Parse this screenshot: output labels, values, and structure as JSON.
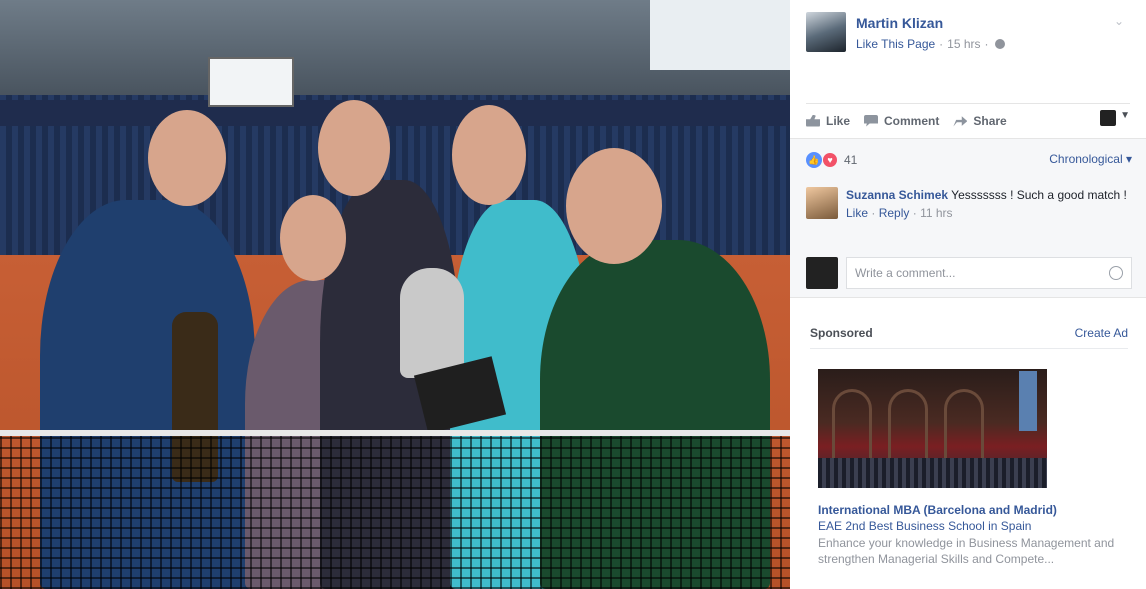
{
  "post": {
    "page_name": "Martin Klizan",
    "like_page": "Like This Page",
    "time": "15 hrs",
    "separator": "·"
  },
  "actions": {
    "like": "Like",
    "comment": "Comment",
    "share": "Share"
  },
  "reactions": {
    "count": "41",
    "sort": "Chronological"
  },
  "comment": {
    "author": "Suzanna Schimek",
    "text": "Yesssssss ! Such a good match !",
    "like": "Like",
    "reply": "Reply",
    "time": "11 hrs",
    "dot": "·"
  },
  "composer": {
    "placeholder": "Write a comment..."
  },
  "sponsored": {
    "title": "Sponsored",
    "create_ad": "Create Ad",
    "ad_title": "International MBA (Barcelona and Madrid)",
    "ad_subtitle": "EAE 2nd Best Business School in Spain",
    "ad_description": "Enhance your knowledge in Business Management and strengthen Managerial Skills and Compete..."
  },
  "colors": {
    "link": "#365899",
    "muted": "#90949c",
    "like_reaction": "#5890ff",
    "love_reaction": "#f25268"
  }
}
